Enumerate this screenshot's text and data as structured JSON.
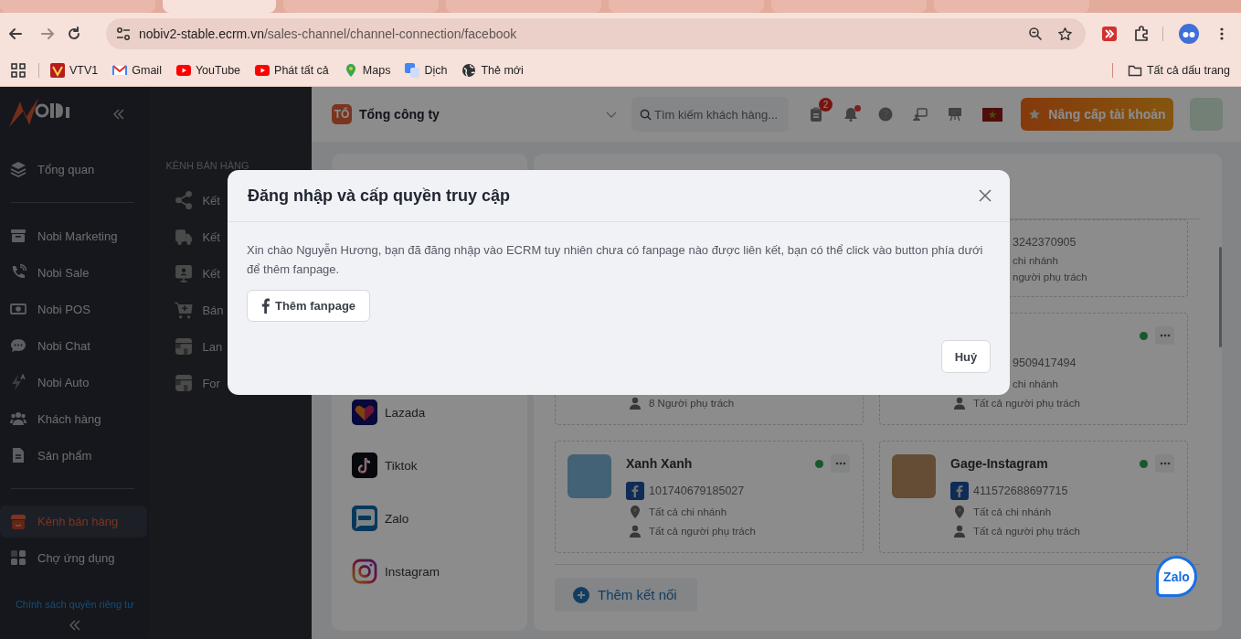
{
  "browser": {
    "address": {
      "domain": "nobiv2-stable.ecrm.vn",
      "path": "/sales-channel/channel-connection/facebook"
    },
    "bookmarks": [
      {
        "label": "VTV1",
        "kind": "vtv"
      },
      {
        "label": "Gmail",
        "kind": "gmail"
      },
      {
        "label": "YouTube",
        "kind": "youtube"
      },
      {
        "label": "Phát tất cả",
        "kind": "youtube"
      },
      {
        "label": "Maps",
        "kind": "maps"
      },
      {
        "label": "Dịch",
        "kind": "translate"
      },
      {
        "label": "Thẻ mới",
        "kind": "globe"
      }
    ],
    "all_bookmarks": "Tất cả dấu trang",
    "tabs": [
      {
        "selected": false
      },
      {
        "selected": true
      },
      {
        "selected": false
      },
      {
        "selected": false
      },
      {
        "selected": false
      },
      {
        "selected": false
      },
      {
        "selected": false
      }
    ]
  },
  "sidebar": {
    "sections": [
      {
        "items": [
          {
            "label": "Tổng quan",
            "kind": "layers",
            "selected": false
          }
        ]
      },
      {
        "items": [
          {
            "label": "Nobi Marketing",
            "kind": "archive",
            "selected": false
          },
          {
            "label": "Nobi Sale",
            "kind": "phone",
            "selected": false
          },
          {
            "label": "Nobi POS",
            "kind": "money",
            "selected": false
          },
          {
            "label": "Nobi Chat",
            "kind": "chat",
            "selected": false
          },
          {
            "label": "Nobi Auto",
            "kind": "bolt",
            "selected": false
          },
          {
            "label": "Khách hàng",
            "kind": "users",
            "selected": false
          },
          {
            "label": "Sản phẩm",
            "kind": "file",
            "selected": false
          }
        ]
      },
      {
        "items": [
          {
            "label": "Kênh bán hàng",
            "kind": "store",
            "selected": true
          },
          {
            "label": "Chợ ứng dụng",
            "kind": "apps",
            "selected": false
          }
        ]
      }
    ],
    "privacy_link": "Chính sách quyền riêng tư"
  },
  "submenu": {
    "heading": "KÊNH BÁN HÀNG",
    "items": [
      {
        "label": "Kết",
        "kind": "share"
      },
      {
        "label": "Kết",
        "kind": "truck"
      },
      {
        "label": "Kết",
        "kind": "kiosk"
      },
      {
        "label": "Bán",
        "kind": "cart"
      },
      {
        "label": "Lan",
        "kind": "layout"
      },
      {
        "label": "For",
        "kind": "layout"
      }
    ]
  },
  "header": {
    "company": {
      "initials": "TỔ",
      "name": "Tổng công ty"
    },
    "search": {
      "placeholder": "Tìm kiếm khách hàng..."
    },
    "task_badge": "2",
    "unread_notifications": true,
    "upgrade_button": "Nâng cấp tài khoản"
  },
  "channels": [
    {
      "label": "Lazada",
      "kind": "lazada"
    },
    {
      "label": "Tiktok",
      "kind": "tiktok"
    },
    {
      "label": "Zalo",
      "kind": "zalo"
    },
    {
      "label": "Instagram",
      "kind": "instagram"
    }
  ],
  "connections": [
    {
      "lines": [
        {
          "kind": "page_id",
          "text": "3242370905",
          "partial": true
        },
        {
          "kind": "branch",
          "text": "chi nhánh",
          "partial": true
        },
        {
          "kind": "owner",
          "text": "người phụ trách",
          "partial": true
        }
      ]
    },
    {
      "lines": [
        {
          "kind": "owner",
          "text": "8 Người phụ trách"
        }
      ]
    },
    {
      "active": true,
      "lines": [
        {
          "kind": "page_id",
          "text": "9509417494",
          "partial": true
        },
        {
          "kind": "branch",
          "text": "chi nhánh",
          "partial": true
        },
        {
          "kind": "owner",
          "text": "Tất cả người phụ trách"
        }
      ]
    },
    {
      "name": "Xanh Xanh",
      "active": true,
      "lines": [
        {
          "kind": "page_id",
          "text": "101740679185027"
        },
        {
          "kind": "branch",
          "text": "Tất cả chi nhánh"
        },
        {
          "kind": "owner",
          "text": "Tất cả người phụ trách"
        }
      ]
    },
    {
      "name": "Gage-Instagram",
      "active": true,
      "lines": [
        {
          "kind": "page_id",
          "text": "411572688697715"
        },
        {
          "kind": "branch",
          "text": "Tất cả chi nhánh"
        },
        {
          "kind": "owner",
          "text": "Tất cả người phụ trách"
        }
      ]
    }
  ],
  "add_connection_button": "Thêm kết nối",
  "modal": {
    "title": "Đăng nhập và cấp quyền truy cập",
    "message": "Xin chào Nguyễn Hương, bạn đã đăng nhập vào ECRM tuy nhiên chưa có fanpage nào được liên kết, bạn có thể click vào button phía dưới để thêm fanpage.",
    "add_fanpage_button": "Thêm fanpage",
    "cancel_button": "Huỷ"
  },
  "chat_widget": "Zalo"
}
